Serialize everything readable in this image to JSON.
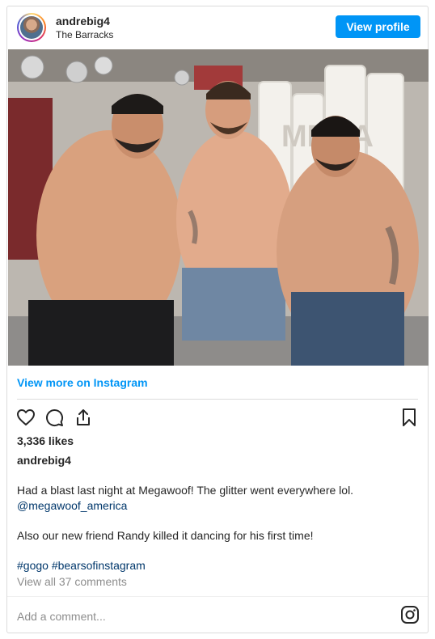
{
  "header": {
    "username": "andrebig4",
    "location": "The Barracks",
    "view_profile_label": "View profile"
  },
  "post": {
    "view_more_label": "View more on Instagram",
    "likes": "3,336 likes",
    "caption_user": "andrebig4",
    "caption_line1": "Had a blast last night at Megawoof! The glitter went everywhere lol.",
    "caption_mention": "@megawoof_america",
    "caption_line2": "Also our new friend Randy killed it dancing for his first time!",
    "hashtag1": "#gogo",
    "hashtag2": "#bearsofinstagram",
    "comments_link": "View all 37 comments",
    "add_comment_placeholder": "Add a comment...",
    "photo_sign_text": "MEGA"
  },
  "icons": {
    "like": "heart-icon",
    "comment": "comment-icon",
    "share": "share-icon",
    "save": "bookmark-icon",
    "instagram": "instagram-icon"
  },
  "colors": {
    "accent": "#0095f6",
    "link_dark": "#00376b",
    "muted": "#8e8e8e",
    "border": "#dbdbdb"
  }
}
